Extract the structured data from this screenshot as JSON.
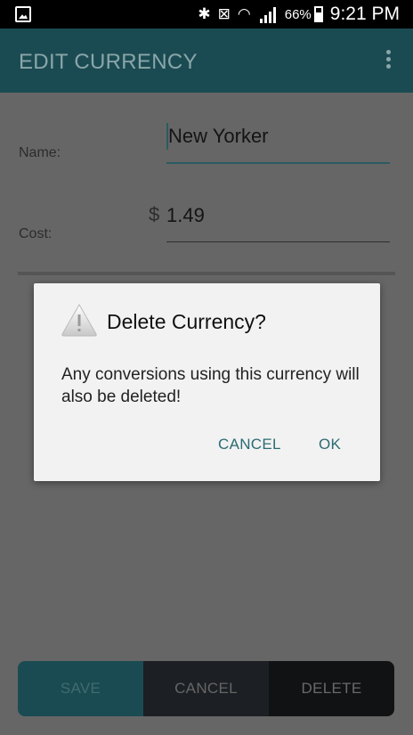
{
  "status_bar": {
    "gallery_icon": "gallery-icon",
    "bluetooth_icon": "bluetooth-icon",
    "vibrate_icon": "vibrate-mute-icon",
    "wifi_icon": "wifi-icon",
    "signal_icon": "signal-icon",
    "battery_percent": "66%",
    "battery_level": 0.66,
    "time": "9:21 PM"
  },
  "app_bar": {
    "title": "EDIT CURRENCY",
    "overflow_icon": "more-vert-icon"
  },
  "form": {
    "name_label": "Name:",
    "name_value": "New Yorker",
    "cost_label": "Cost:",
    "currency_symbol": "$",
    "cost_value": "1.49"
  },
  "dialog": {
    "icon": "warning-icon",
    "title": "Delete Currency?",
    "message": "Any conversions using this currency will also be deleted!",
    "cancel_label": "CANCEL",
    "ok_label": "OK"
  },
  "bottom_bar": {
    "save_label": "SAVE",
    "cancel_label": "CANCEL",
    "delete_label": "DELETE"
  },
  "colors": {
    "accent": "#2b6b73",
    "app_bar": "#1b4b52",
    "scrim": "#666666"
  }
}
